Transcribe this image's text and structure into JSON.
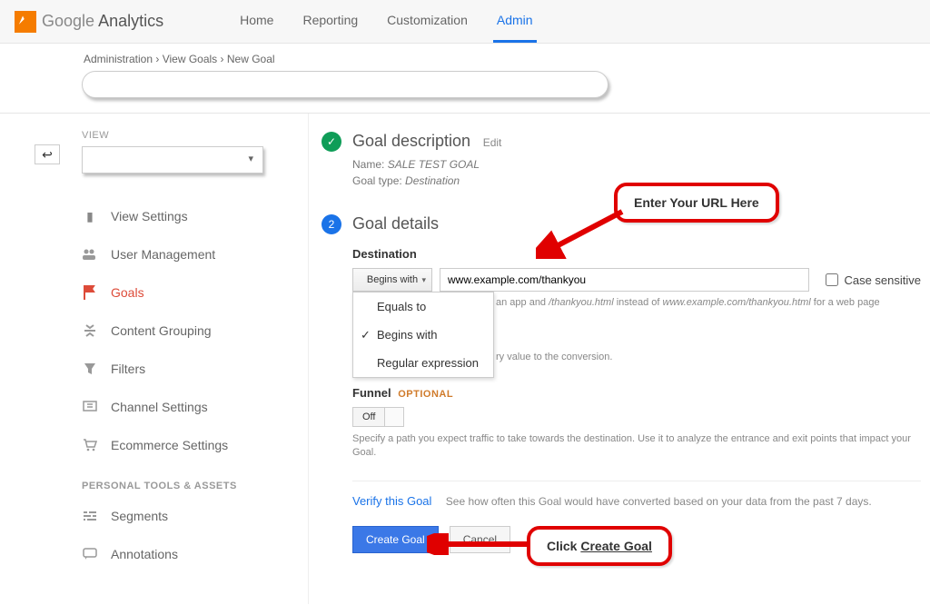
{
  "header": {
    "logo_primary": "Google",
    "logo_secondary": "Analytics",
    "nav": [
      "Home",
      "Reporting",
      "Customization",
      "Admin"
    ],
    "active_nav": "Admin"
  },
  "breadcrumb": [
    "Administration",
    "View Goals",
    "New Goal"
  ],
  "sidebar": {
    "view_label": "VIEW",
    "items": [
      {
        "label": "View Settings",
        "icon": "file-icon"
      },
      {
        "label": "User Management",
        "icon": "users-icon"
      },
      {
        "label": "Goals",
        "icon": "flag-icon",
        "active": true
      },
      {
        "label": "Content Grouping",
        "icon": "group-icon"
      },
      {
        "label": "Filters",
        "icon": "funnel-icon"
      },
      {
        "label": "Channel Settings",
        "icon": "channel-icon"
      },
      {
        "label": "Ecommerce Settings",
        "icon": "cart-icon"
      }
    ],
    "section2_heading": "PERSONAL TOOLS & ASSETS",
    "section2_items": [
      {
        "label": "Segments",
        "icon": "segments-icon"
      },
      {
        "label": "Annotations",
        "icon": "annotations-icon"
      }
    ]
  },
  "step1": {
    "title": "Goal description",
    "edit": "Edit",
    "name_label": "Name:",
    "name_value": "SALE TEST GOAL",
    "type_label": "Goal type:",
    "type_value": "Destination"
  },
  "step2": {
    "badge": "2",
    "title": "Goal details",
    "dest_label": "Destination",
    "match_selected": "Begins with",
    "match_options": [
      "Equals to",
      "Begins with",
      "Regular expression"
    ],
    "url_value": "www.example.com/thankyou",
    "case_sensitive": "Case sensitive",
    "hint_suffix": "an app and ",
    "hint_path": "/thankyou.html",
    "hint_mid": " instead of ",
    "hint_full": "www.example.com/thankyou.html",
    "hint_end": " for a web page",
    "value_hint": "ry value to the conversion.",
    "funnel_label": "Funnel",
    "funnel_optional": "OPTIONAL",
    "toggle": "Off",
    "funnel_hint": "Specify a path you expect traffic to take towards the destination. Use it to analyze the entrance and exit points that impact your Goal.",
    "verify_link": "Verify this Goal",
    "verify_text": "See how often this Goal would have converted based on your data from the past 7 days.",
    "btn_primary": "Create Goal",
    "btn_cancel": "Cancel"
  },
  "callouts": {
    "url": "Enter Your URL Here",
    "create_prefix": "Click ",
    "create_action": "Create Goal"
  }
}
